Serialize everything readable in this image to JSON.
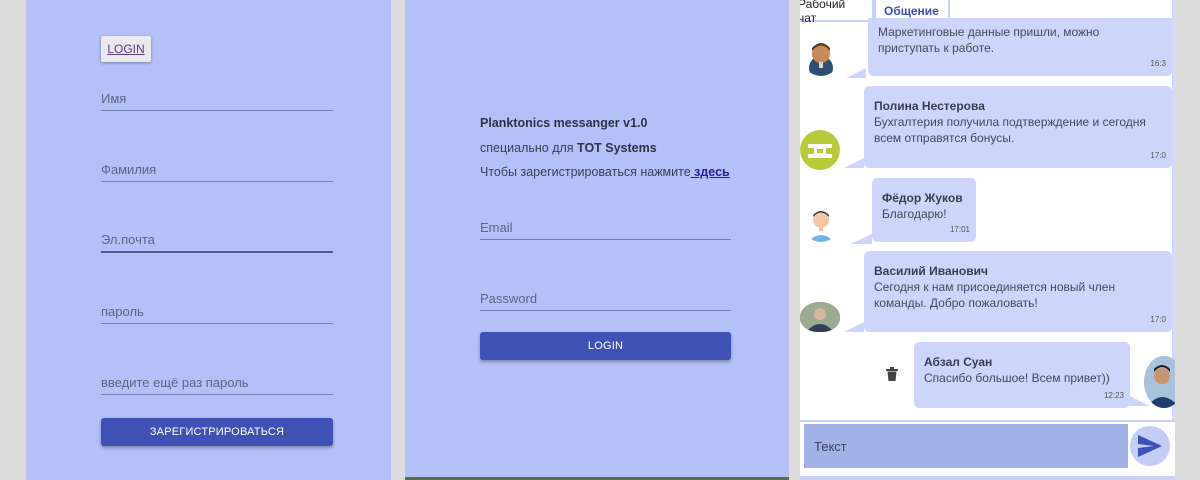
{
  "register": {
    "login_button": "LOGIN",
    "fields": {
      "first_name": "Имя",
      "last_name": "Фамилия",
      "email": "Эл.почта",
      "password": "пароль",
      "password_repeat": "введите ещё раз пароль"
    },
    "submit": "ЗАРЕГИСТРИРОВАТЬСЯ"
  },
  "login": {
    "title": "Planktonics messanger v1.0",
    "subtitle_prefix": "специально для ",
    "subtitle_company": "TOT Systems",
    "register_prompt": "Чтобы зарегистрироваться нажмите",
    "register_link": " здесь",
    "email_placeholder": "Email",
    "password_placeholder": "Password",
    "submit": "LOGIN"
  },
  "chat": {
    "tabs": [
      {
        "label": "Рабочий чат"
      },
      {
        "label": "Общение"
      }
    ],
    "messages": [
      {
        "author": "",
        "text": "Маркетинговые данные пришли, можно приступать к работе.",
        "time": "16:3"
      },
      {
        "author": "Полина Нестерова",
        "text": "Бухгалтерия получила подтверждение и сегодня всем отправятся бонусы.",
        "time": "17:0"
      },
      {
        "author": "Фёдор Жуков",
        "text": "Благодарю!",
        "time": "17:01"
      },
      {
        "author": "Василий Иванович",
        "text": "Сегодня к нам присоединяется новый член команды. Добро пожаловать!",
        "time": "17:0"
      },
      {
        "author": "Абзал Суан",
        "text": "Спасибо большое! Всем привет))",
        "time": "12:23"
      }
    ],
    "input_placeholder": "Текст",
    "colors": {
      "accent": "#3f51b5",
      "panel_bg": "#b4c1f8",
      "bubble": "#cdd6fa"
    }
  }
}
